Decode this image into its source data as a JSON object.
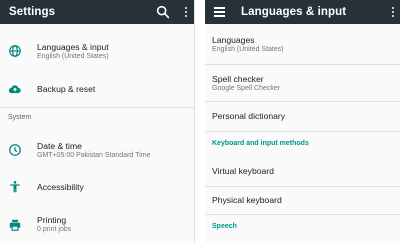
{
  "left": {
    "title": "Settings",
    "icons": {
      "search": "search-icon",
      "more": "more-vert-icon"
    },
    "items": [
      {
        "id": "languages-input",
        "icon": "globe-icon",
        "title": "Languages & input",
        "subtitle": "English (United States)"
      },
      {
        "id": "backup-reset",
        "icon": "cloud-upload-icon",
        "title": "Backup & reset"
      },
      {
        "id": "date-time",
        "icon": "clock-icon",
        "title": "Date & time",
        "subtitle": "GMT+05:00 Pakistan Standard Time"
      },
      {
        "id": "accessibility",
        "icon": "accessibility-icon",
        "title": "Accessibility"
      },
      {
        "id": "printing",
        "icon": "printer-icon",
        "title": "Printing",
        "subtitle": "0 print jobs"
      }
    ],
    "section_system": "System"
  },
  "right": {
    "title": "Languages & input",
    "icons": {
      "menu": "menu-icon",
      "more": "more-vert-icon"
    },
    "items": [
      {
        "id": "languages",
        "title": "Languages",
        "subtitle": "English (United States)"
      },
      {
        "id": "spell-checker",
        "title": "Spell checker",
        "subtitle": "Google Spell Checker"
      },
      {
        "id": "personal-dictionary",
        "title": "Personal dictionary"
      },
      {
        "id": "virtual-keyboard",
        "title": "Virtual keyboard"
      },
      {
        "id": "physical-keyboard",
        "title": "Physical keyboard"
      }
    ],
    "section_keyboard": "Keyboard and input methods",
    "section_speech": "Speech"
  },
  "colors": {
    "appbar": "#263238",
    "accent": "#009688",
    "icon": "#00897b"
  }
}
